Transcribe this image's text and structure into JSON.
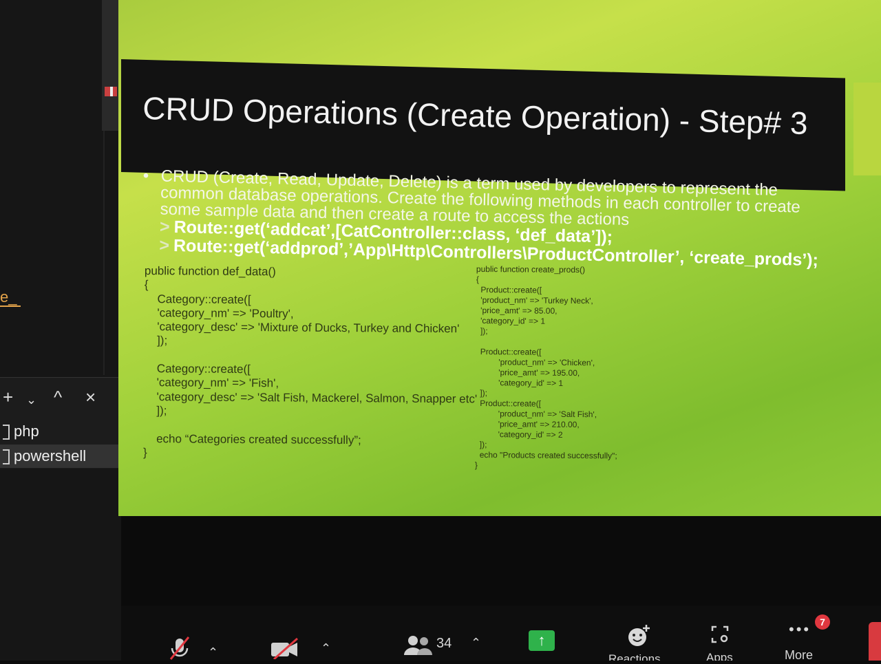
{
  "terminal": {
    "fragment": "e_",
    "controls": {
      "add": "+",
      "dropdown": "⌄",
      "maximize": "^",
      "close": "×"
    },
    "items": [
      {
        "label": "php",
        "active": false
      },
      {
        "label": "powershell",
        "active": true
      }
    ]
  },
  "slide": {
    "title": "CRUD Operations (Create Operation) - Step# 3",
    "bullet": [
      "CRUD (Create, Read, Update, Delete) is a term used by developers to represent the",
      "common database operations. Create the following methods in each controller to create",
      "some sample data and then create a route to access the actions"
    ],
    "routes": [
      "Route::get(‘addcat’,[CatController::class, ‘def_data’]);",
      "Route::get(‘addprod’,’App\\Http\\Controllers\\ProductController’, ‘create_prods’);"
    ],
    "code_left": [
      "public function def_data()",
      "{",
      "    Category::create([",
      "    'category_nm' => 'Poultry',",
      "    'category_desc' => 'Mixture of Ducks, Turkey and Chicken'",
      "    ]);",
      "",
      "    Category::create([",
      "    'category_nm' => 'Fish',",
      "    'category_desc' => 'Salt Fish, Mackerel, Salmon, Snapper etc'",
      "    ]);",
      "",
      "    echo “Categories created successfully”;",
      "}"
    ],
    "code_right": [
      "public function create_prods()",
      "{",
      "  Product::create([",
      "  'product_nm' => 'Turkey Neck',",
      "  'price_amt' => 85.00,",
      "  'category_id' => 1",
      "  ]);",
      "",
      "  Product::create([",
      "          'product_nm' => 'Chicken',",
      "          'price_amt' => 195.00,",
      "          'category_id' => 1",
      "  ]);",
      "  Product::create([",
      "          'product_nm' => 'Salt Fish',",
      "          'price_amt' => 210.00,",
      "          'category_id' => 2",
      "  ]);",
      "  echo \"Products created successfully\";",
      "}"
    ]
  },
  "toolbar": {
    "participants_count": "34",
    "reactions_label": "Reactions",
    "apps_label": "Apps",
    "more_label": "More",
    "more_badge": "7",
    "accent_share": "#2fb24b",
    "accent_badge": "#e0373f"
  }
}
